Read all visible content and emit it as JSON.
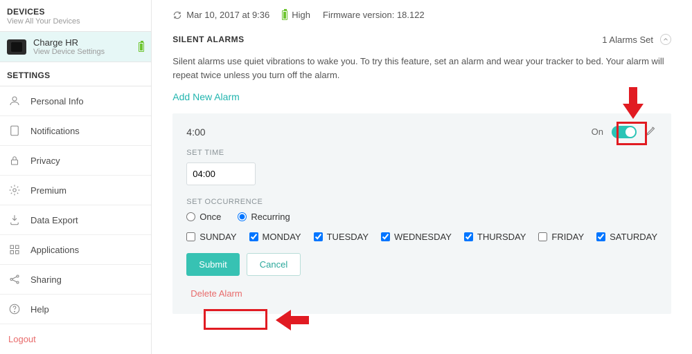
{
  "sidebar": {
    "devices_title": "DEVICES",
    "devices_sub": "View All Your Devices",
    "device": {
      "name": "Charge HR",
      "sub": "View Device Settings"
    },
    "settings_title": "SETTINGS",
    "items": [
      {
        "label": "Personal Info"
      },
      {
        "label": "Notifications"
      },
      {
        "label": "Privacy"
      },
      {
        "label": "Premium"
      },
      {
        "label": "Data Export"
      },
      {
        "label": "Applications"
      },
      {
        "label": "Sharing"
      },
      {
        "label": "Help"
      }
    ],
    "logout": "Logout"
  },
  "status": {
    "sync_time": "Mar 10, 2017 at 9:36",
    "battery": "High",
    "firmware_label": "Firmware version:",
    "firmware_value": "18.122"
  },
  "alarms": {
    "section_title": "SILENT ALARMS",
    "count_label": "1 Alarms Set",
    "description": "Silent alarms use quiet vibrations to wake you. To try this feature, set an alarm and wear your tracker to bed. Your alarm will repeat twice unless you turn off the alarm.",
    "add_link": "Add New Alarm",
    "card": {
      "time_label": "4:00",
      "on_label": "On",
      "set_time_label": "SET TIME",
      "time_value": "04:00",
      "set_occurrence_label": "SET OCCURRENCE",
      "occurrence": {
        "once": "Once",
        "recurring": "Recurring",
        "selected": "recurring"
      },
      "days": [
        {
          "label": "SUNDAY",
          "checked": false
        },
        {
          "label": "MONDAY",
          "checked": true
        },
        {
          "label": "TUESDAY",
          "checked": true
        },
        {
          "label": "WEDNESDAY",
          "checked": true
        },
        {
          "label": "THURSDAY",
          "checked": true
        },
        {
          "label": "FRIDAY",
          "checked": false
        },
        {
          "label": "SATURDAY",
          "checked": true
        }
      ],
      "submit": "Submit",
      "cancel": "Cancel",
      "delete": "Delete Alarm"
    }
  }
}
